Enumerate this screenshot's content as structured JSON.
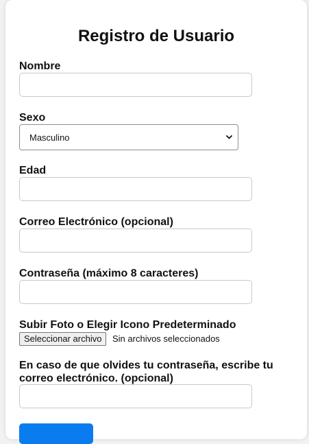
{
  "form": {
    "title": "Registro de Usuario",
    "name_label": "Nombre",
    "name_value": "",
    "sex_label": "Sexo",
    "sex_selected": "Masculino",
    "age_label": "Edad",
    "age_value": "",
    "email_label": "Correo Electrónico (opcional)",
    "email_value": "",
    "password_label": "Contraseña (máximo 8 caracteres)",
    "password_value": "",
    "photo_label": "Subir Foto o Elegir Icono Predeterminado",
    "file_button_label": "Seleccionar archivo",
    "file_status": "Sin archivos seleccionados",
    "recovery_label": "En caso de que olvides tu contraseña, escribe tu correo electrónico. (opcional)",
    "recovery_value": "",
    "submit_label": ""
  },
  "colors": {
    "accent": "#0a7cf0",
    "card": "#ffffff",
    "background": "#f2f2f2"
  },
  "icons": {
    "select_arrow": "chevron-down-icon"
  }
}
